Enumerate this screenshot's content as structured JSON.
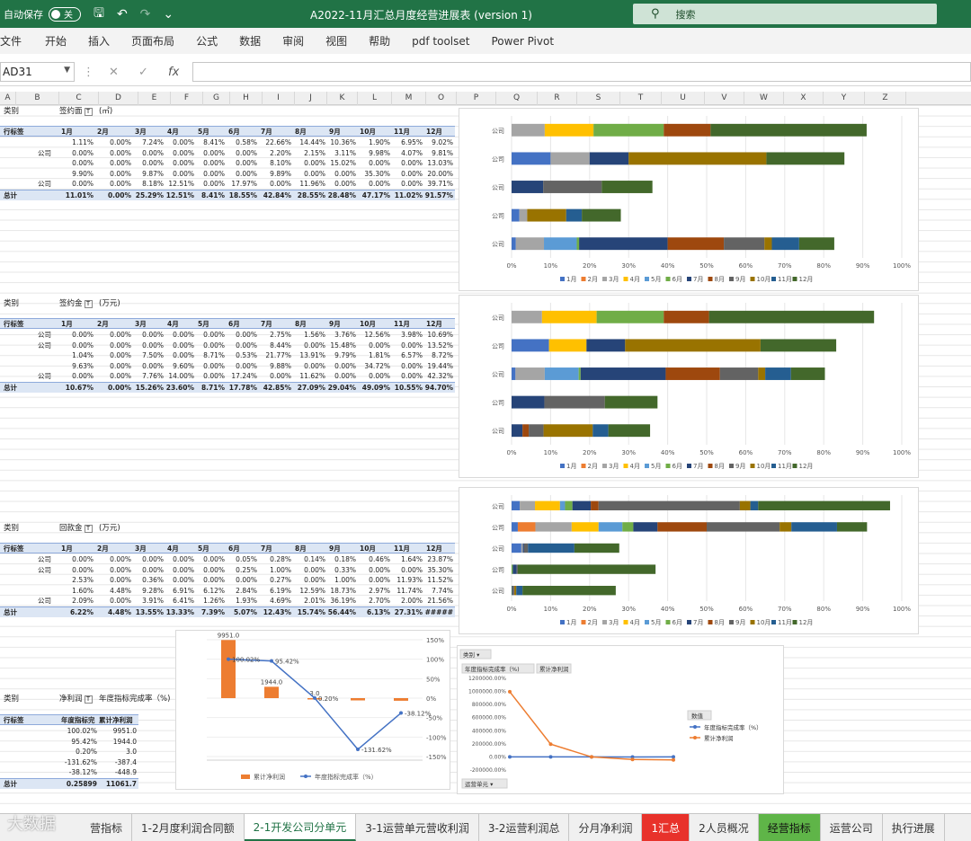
{
  "titlebar": {
    "autosave_label": "自动保存",
    "toggle_label": "关",
    "doc_title": "A2022-11月汇总月度经营进展表 (version 1)",
    "search_label": "搜索",
    "accent": "#217346"
  },
  "menu": [
    "文件",
    "开始",
    "插入",
    "页面布局",
    "公式",
    "数据",
    "审阅",
    "视图",
    "帮助",
    "pdf toolset",
    "Power Pivot"
  ],
  "formula": {
    "cell_ref": "AD31",
    "fx": "fx"
  },
  "columns": [
    "A",
    "B",
    "C",
    "D",
    "E",
    "F",
    "G",
    "H",
    "I",
    "J",
    "K",
    "L",
    "M",
    "O",
    "P",
    "Q",
    "R",
    "S",
    "T",
    "U",
    "V",
    "W",
    "X",
    "Y",
    "Z"
  ],
  "pivot_months": [
    "1月",
    "2月",
    "3月",
    "4月",
    "5月",
    "6月",
    "7月",
    "8月",
    "9月",
    "10月",
    "11月",
    "12月"
  ],
  "pivot1": {
    "category": "类别",
    "field": "签约面",
    "unit": "(㎡)",
    "row_label": "行标签",
    "rows": [
      {
        "label": "",
        "vals": [
          "1.11%",
          "0.00%",
          "7.24%",
          "0.00%",
          "8.41%",
          "0.58%",
          "22.66%",
          "14.44%",
          "10.36%",
          "1.90%",
          "6.95%",
          "9.02%"
        ]
      },
      {
        "label": "公司",
        "vals": [
          "0.00%",
          "0.00%",
          "0.00%",
          "0.00%",
          "0.00%",
          "0.00%",
          "2.20%",
          "2.15%",
          "3.11%",
          "9.98%",
          "4.07%",
          "9.81%"
        ]
      },
      {
        "label": "",
        "vals": [
          "0.00%",
          "0.00%",
          "0.00%",
          "0.00%",
          "0.00%",
          "0.00%",
          "8.10%",
          "0.00%",
          "15.02%",
          "0.00%",
          "0.00%",
          "13.03%"
        ]
      },
      {
        "label": "",
        "vals": [
          "9.90%",
          "0.00%",
          "9.87%",
          "0.00%",
          "0.00%",
          "0.00%",
          "9.89%",
          "0.00%",
          "0.00%",
          "35.30%",
          "0.00%",
          "20.00%"
        ]
      },
      {
        "label": "公司",
        "vals": [
          "0.00%",
          "0.00%",
          "8.18%",
          "12.51%",
          "0.00%",
          "17.97%",
          "0.00%",
          "11.96%",
          "0.00%",
          "0.00%",
          "0.00%",
          "39.71%"
        ]
      }
    ],
    "total_label": "总计",
    "total": [
      "11.01%",
      "0.00%",
      "25.29%",
      "12.51%",
      "8.41%",
      "18.55%",
      "42.84%",
      "28.55%",
      "28.48%",
      "47.17%",
      "11.02%",
      "91.57%"
    ]
  },
  "pivot2": {
    "category": "类别",
    "field": "签约金",
    "unit": "(万元)",
    "row_label": "行标签",
    "rows": [
      {
        "label": "公司",
        "vals": [
          "0.00%",
          "0.00%",
          "0.00%",
          "0.00%",
          "0.00%",
          "0.00%",
          "2.75%",
          "1.56%",
          "3.76%",
          "12.56%",
          "3.98%",
          "10.69%"
        ]
      },
      {
        "label": "公司",
        "vals": [
          "0.00%",
          "0.00%",
          "0.00%",
          "0.00%",
          "0.00%",
          "0.00%",
          "8.44%",
          "0.00%",
          "15.48%",
          "0.00%",
          "0.00%",
          "13.52%"
        ]
      },
      {
        "label": "",
        "vals": [
          "1.04%",
          "0.00%",
          "7.50%",
          "0.00%",
          "8.71%",
          "0.53%",
          "21.77%",
          "13.91%",
          "9.79%",
          "1.81%",
          "6.57%",
          "8.72%"
        ]
      },
      {
        "label": "",
        "vals": [
          "9.63%",
          "0.00%",
          "0.00%",
          "9.60%",
          "0.00%",
          "0.00%",
          "9.88%",
          "0.00%",
          "0.00%",
          "34.72%",
          "0.00%",
          "19.44%"
        ]
      },
      {
        "label": "公司",
        "vals": [
          "0.00%",
          "0.00%",
          "7.76%",
          "14.00%",
          "0.00%",
          "17.24%",
          "0.00%",
          "11.62%",
          "0.00%",
          "0.00%",
          "0.00%",
          "42.32%"
        ]
      }
    ],
    "total_label": "总计",
    "total": [
      "10.67%",
      "0.00%",
      "15.26%",
      "23.60%",
      "8.71%",
      "17.78%",
      "42.85%",
      "27.09%",
      "29.04%",
      "49.09%",
      "10.55%",
      "94.70%"
    ]
  },
  "pivot3": {
    "category": "类别",
    "field": "回款金",
    "unit": "(万元)",
    "row_label": "行标签",
    "rows": [
      {
        "label": "公司",
        "vals": [
          "0.00%",
          "0.00%",
          "0.00%",
          "0.00%",
          "0.00%",
          "0.05%",
          "0.28%",
          "0.14%",
          "0.18%",
          "0.46%",
          "1.64%",
          "23.87%"
        ]
      },
      {
        "label": "公司",
        "vals": [
          "0.00%",
          "0.00%",
          "0.00%",
          "0.00%",
          "0.00%",
          "0.25%",
          "1.00%",
          "0.00%",
          "0.33%",
          "0.00%",
          "0.00%",
          "35.30%"
        ]
      },
      {
        "label": "",
        "vals": [
          "2.53%",
          "0.00%",
          "0.36%",
          "0.00%",
          "0.00%",
          "0.00%",
          "0.27%",
          "0.00%",
          "1.00%",
          "0.00%",
          "11.93%",
          "11.52%"
        ]
      },
      {
        "label": "",
        "vals": [
          "1.60%",
          "4.48%",
          "9.28%",
          "6.91%",
          "6.12%",
          "2.84%",
          "6.19%",
          "12.59%",
          "18.73%",
          "2.97%",
          "11.74%",
          "7.74%"
        ]
      },
      {
        "label": "公司",
        "vals": [
          "2.09%",
          "0.00%",
          "3.91%",
          "6.41%",
          "1.26%",
          "1.93%",
          "4.69%",
          "2.01%",
          "36.19%",
          "2.70%",
          "2.00%",
          "21.56%"
        ]
      }
    ],
    "total_label": "总计",
    "total": [
      "6.22%",
      "4.48%",
      "13.55%",
      "13.33%",
      "7.39%",
      "5.07%",
      "12.43%",
      "15.74%",
      "56.44%",
      "6.13%",
      "27.31%",
      "#####"
    ]
  },
  "pivot4": {
    "category": "类别",
    "field": "净利润",
    "field2": "年度指标完成率（%)",
    "row_label": "行标签",
    "col1": "年度指标完",
    "col2": "累计净利润",
    "rows": [
      {
        "a": "100.02%",
        "b": "9951.0"
      },
      {
        "a": "95.42%",
        "b": "1944.0"
      },
      {
        "a": "0.20%",
        "b": "3.0"
      },
      {
        "a": "-131.62%",
        "b": "-387.4"
      },
      {
        "a": "-38.12%",
        "b": "-448.9"
      }
    ],
    "total_label": "总计",
    "total": {
      "a": "0.25899",
      "b": "11061.7"
    }
  },
  "colors": {
    "m1": "#4472c4",
    "m2": "#ed7d31",
    "m3": "#a5a5a5",
    "m4": "#ffc000",
    "m5": "#5b9bd5",
    "m6": "#70ad47",
    "m7": "#264478",
    "m8": "#9e480e",
    "m9": "#636363",
    "m10": "#997300",
    "m11": "#255e91",
    "m12": "#43682b"
  },
  "chart_data": [
    {
      "type": "bar",
      "orientation": "horizontal-stacked",
      "categories": [
        "公司",
        "公司",
        "公司",
        "公司",
        "公司"
      ],
      "series_names": [
        "1月",
        "2月",
        "3月",
        "4月",
        "5月",
        "6月",
        "7月",
        "8月",
        "9月",
        "10月",
        "11月",
        "12月"
      ],
      "matrix": [
        [
          0,
          0,
          8.5,
          12.5,
          0,
          18.0,
          0,
          12.0,
          0,
          0,
          0,
          40.0
        ],
        [
          10.0,
          0,
          10.0,
          0,
          0,
          0,
          10.0,
          0,
          0,
          35.3,
          0,
          20.0
        ],
        [
          0,
          0,
          0,
          0,
          0,
          0,
          8.1,
          0,
          15.0,
          0,
          0,
          13.0
        ],
        [
          2.0,
          0,
          2.0,
          0,
          0,
          0,
          0,
          0,
          0,
          10.0,
          4.0,
          10.0
        ],
        [
          1.1,
          0,
          7.2,
          0,
          8.4,
          0.6,
          22.7,
          14.4,
          10.4,
          1.9,
          7.0,
          9.0
        ]
      ],
      "xticks": [
        "0%",
        "10%",
        "20%",
        "30%",
        "40%",
        "50%",
        "60%",
        "70%",
        "80%",
        "90%",
        "100%"
      ],
      "xlim": [
        0,
        100
      ],
      "legend": "bottom"
    },
    {
      "type": "bar",
      "orientation": "horizontal-stacked",
      "categories": [
        "公司",
        "公司",
        "公司",
        "公司",
        "公司"
      ],
      "series_names": [
        "1月",
        "2月",
        "3月",
        "4月",
        "5月",
        "6月",
        "7月",
        "8月",
        "9月",
        "10月",
        "11月",
        "12月"
      ],
      "matrix": [
        [
          0,
          0,
          7.8,
          14.0,
          0,
          17.2,
          0,
          11.6,
          0,
          0,
          0,
          42.3
        ],
        [
          9.6,
          0,
          0,
          9.6,
          0,
          0,
          9.9,
          0,
          0,
          34.7,
          0,
          19.4
        ],
        [
          1.0,
          0,
          7.5,
          0,
          8.7,
          0.5,
          21.8,
          13.9,
          9.8,
          1.8,
          6.6,
          8.7
        ],
        [
          0,
          0,
          0,
          0,
          0,
          0,
          8.4,
          0,
          15.5,
          0,
          0,
          13.5
        ],
        [
          0,
          0,
          0,
          0,
          0,
          0,
          2.8,
          1.6,
          3.8,
          12.6,
          4.0,
          10.7
        ]
      ],
      "xticks": [
        "0%",
        "10%",
        "20%",
        "30%",
        "40%",
        "50%",
        "60%",
        "70%",
        "80%",
        "90%",
        "100%"
      ],
      "xlim": [
        0,
        100
      ],
      "legend": "bottom"
    },
    {
      "type": "bar",
      "orientation": "horizontal-stacked",
      "categories": [
        "公司",
        "公司",
        "公司",
        "公司",
        "公司"
      ],
      "series_names": [
        "1月",
        "2月",
        "3月",
        "4月",
        "5月",
        "6月",
        "7月",
        "8月",
        "9月",
        "10月",
        "11月",
        "12月"
      ],
      "matrix": [
        [
          2.1,
          0,
          3.9,
          6.4,
          1.3,
          1.9,
          4.7,
          2.0,
          36.2,
          2.7,
          2.0,
          33.8
        ],
        [
          1.6,
          4.5,
          9.3,
          6.9,
          6.1,
          2.8,
          6.2,
          12.6,
          18.7,
          3.0,
          11.7,
          7.7
        ],
        [
          2.5,
          0,
          0.4,
          0,
          0,
          0,
          0.3,
          0,
          1.0,
          0,
          11.9,
          11.5
        ],
        [
          0,
          0,
          0,
          0,
          0,
          0.3,
          1.0,
          0,
          0.3,
          0,
          0,
          35.3
        ],
        [
          0,
          0,
          0,
          0,
          0,
          0.1,
          0.3,
          0.1,
          0.2,
          0.5,
          1.6,
          23.9
        ]
      ],
      "xticks": [
        "0%",
        "10%",
        "20%",
        "30%",
        "40%",
        "50%",
        "60%",
        "70%",
        "80%",
        "90%",
        "100%"
      ],
      "xlim": [
        0,
        100
      ],
      "legend": "bottom"
    },
    {
      "type": "bar",
      "combo": "bar+line",
      "series": [
        {
          "name": "累计净利润",
          "values": [
            9951.0,
            1944.0,
            3.0,
            -387.4,
            -448.9
          ],
          "labels": [
            "9951.0",
            "1944.0",
            "3.0",
            "",
            ""
          ]
        },
        {
          "name": "年度指标完成率（%）",
          "values": [
            100.02,
            95.42,
            0.2,
            -131.62,
            -38.12
          ],
          "labels": [
            "100.02%",
            "95.42%",
            "0.20%",
            "-131.62%",
            "-38.12%"
          ]
        }
      ],
      "y2ticks": [
        "150%",
        "100%",
        "50%",
        "0%",
        "-50%",
        "-100%",
        "-150%"
      ],
      "y2lim": [
        -150,
        150
      ],
      "legend": "bottom"
    },
    {
      "type": "line",
      "series": [
        {
          "name": "年度指标完成率（%）",
          "values": [
            100.02,
            95.42,
            0.2,
            -131.62,
            -38.12
          ]
        },
        {
          "name": "累计净利润",
          "values": [
            995100,
            194400,
            300,
            -38740,
            -44890
          ]
        }
      ],
      "yticks": [
        "1200000.00%",
        "1000000.00%",
        "800000.00%",
        "600000.00%",
        "400000.00%",
        "200000.00%",
        "0.00%",
        "-200000.00%"
      ],
      "ylim": [
        -200000,
        1200000
      ],
      "field_buttons": {
        "top": "类别",
        "col1": "年度指标完成率（%)",
        "col2": "累计净利润",
        "bottom": "运营单元"
      },
      "legend_title": "数值",
      "legend": "right"
    }
  ],
  "tabs": [
    {
      "label": "营指标",
      "style": ""
    },
    {
      "label": "1-2月度利润合同额",
      "style": ""
    },
    {
      "label": "2-1开发公司分单元",
      "style": "active"
    },
    {
      "label": "3-1运营单元营收利润",
      "style": ""
    },
    {
      "label": "3-2运营利润总",
      "style": ""
    },
    {
      "label": "分月净利润",
      "style": ""
    },
    {
      "label": "1汇总",
      "style": "red"
    },
    {
      "label": "2人员概况",
      "style": ""
    },
    {
      "label": "经营指标",
      "style": "green"
    },
    {
      "label": "运营公司",
      "style": ""
    },
    {
      "label": "执行进展",
      "style": ""
    }
  ],
  "watermark": "大数据"
}
